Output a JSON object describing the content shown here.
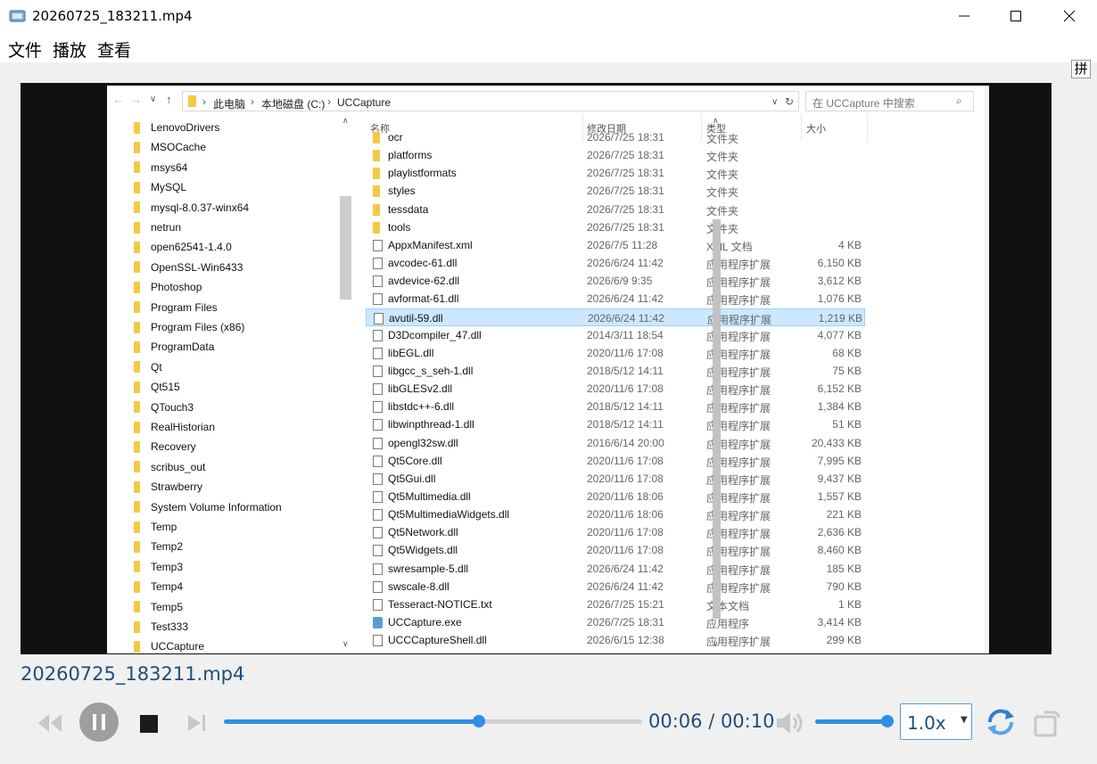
{
  "window": {
    "title": "20260725_183211.mp4",
    "icon": "video-player-icon",
    "minimize_icon": "minimize-icon",
    "maximize_icon": "maximize-icon",
    "close_icon": "close-icon"
  },
  "menu": [
    "文件",
    "播放",
    "查看"
  ],
  "ime_indicator": "拼",
  "explorer": {
    "breadcrumb": [
      "此电脑",
      "本地磁盘 (C:)",
      "UCCapture"
    ],
    "search_placeholder": "在 UCCapture 中搜索",
    "nav_folders": [
      "LenovoDrivers",
      "MSOCache",
      "msys64",
      "MySQL",
      "mysql-8.0.37-winx64",
      "netrun",
      "open62541-1.4.0",
      "OpenSSL-Win6433",
      "Photoshop",
      "Program Files",
      "Program Files (x86)",
      "ProgramData",
      "Qt",
      "Qt515",
      "QTouch3",
      "RealHistorian",
      "Recovery",
      "scribus_out",
      "Strawberry",
      "System Volume Information",
      "Temp",
      "Temp2",
      "Temp3",
      "Temp4",
      "Temp5",
      "Test333",
      "UCCapture"
    ],
    "columns": [
      "名称",
      "修改日期",
      "类型",
      "大小"
    ],
    "files": [
      {
        "name": "ocr",
        "date": "2026/7/25 18:31",
        "type": "文件夹",
        "size": "",
        "kind": "folder"
      },
      {
        "name": "platforms",
        "date": "2026/7/25 18:31",
        "type": "文件夹",
        "size": "",
        "kind": "folder"
      },
      {
        "name": "playlistformats",
        "date": "2026/7/25 18:31",
        "type": "文件夹",
        "size": "",
        "kind": "folder"
      },
      {
        "name": "styles",
        "date": "2026/7/25 18:31",
        "type": "文件夹",
        "size": "",
        "kind": "folder"
      },
      {
        "name": "tessdata",
        "date": "2026/7/25 18:31",
        "type": "文件夹",
        "size": "",
        "kind": "folder"
      },
      {
        "name": "tools",
        "date": "2026/7/25 18:31",
        "type": "文件夹",
        "size": "",
        "kind": "folder"
      },
      {
        "name": "AppxManifest.xml",
        "date": "2026/7/5 11:28",
        "type": "XML 文档",
        "size": "4 KB",
        "kind": "doc"
      },
      {
        "name": "avcodec-61.dll",
        "date": "2026/6/24 11:42",
        "type": "应用程序扩展",
        "size": "6,150 KB",
        "kind": "doc"
      },
      {
        "name": "avdevice-62.dll",
        "date": "2026/6/9 9:35",
        "type": "应用程序扩展",
        "size": "3,612 KB",
        "kind": "doc"
      },
      {
        "name": "avformat-61.dll",
        "date": "2026/6/24 11:42",
        "type": "应用程序扩展",
        "size": "1,076 KB",
        "kind": "doc"
      },
      {
        "name": "avutil-59.dll",
        "date": "2026/6/24 11:42",
        "type": "应用程序扩展",
        "size": "1,219 KB",
        "kind": "doc",
        "selected": true
      },
      {
        "name": "D3Dcompiler_47.dll",
        "date": "2014/3/11 18:54",
        "type": "应用程序扩展",
        "size": "4,077 KB",
        "kind": "doc"
      },
      {
        "name": "libEGL.dll",
        "date": "2020/11/6 17:08",
        "type": "应用程序扩展",
        "size": "68 KB",
        "kind": "doc"
      },
      {
        "name": "libgcc_s_seh-1.dll",
        "date": "2018/5/12 14:11",
        "type": "应用程序扩展",
        "size": "75 KB",
        "kind": "doc"
      },
      {
        "name": "libGLESv2.dll",
        "date": "2020/11/6 17:08",
        "type": "应用程序扩展",
        "size": "6,152 KB",
        "kind": "doc"
      },
      {
        "name": "libstdc++-6.dll",
        "date": "2018/5/12 14:11",
        "type": "应用程序扩展",
        "size": "1,384 KB",
        "kind": "doc"
      },
      {
        "name": "libwinpthread-1.dll",
        "date": "2018/5/12 14:11",
        "type": "应用程序扩展",
        "size": "51 KB",
        "kind": "doc"
      },
      {
        "name": "opengl32sw.dll",
        "date": "2016/6/14 20:00",
        "type": "应用程序扩展",
        "size": "20,433 KB",
        "kind": "doc"
      },
      {
        "name": "Qt5Core.dll",
        "date": "2020/11/6 17:08",
        "type": "应用程序扩展",
        "size": "7,995 KB",
        "kind": "doc"
      },
      {
        "name": "Qt5Gui.dll",
        "date": "2020/11/6 17:08",
        "type": "应用程序扩展",
        "size": "9,437 KB",
        "kind": "doc"
      },
      {
        "name": "Qt5Multimedia.dll",
        "date": "2020/11/6 18:06",
        "type": "应用程序扩展",
        "size": "1,557 KB",
        "kind": "doc"
      },
      {
        "name": "Qt5MultimediaWidgets.dll",
        "date": "2020/11/6 18:06",
        "type": "应用程序扩展",
        "size": "221 KB",
        "kind": "doc"
      },
      {
        "name": "Qt5Network.dll",
        "date": "2020/11/6 17:08",
        "type": "应用程序扩展",
        "size": "2,636 KB",
        "kind": "doc"
      },
      {
        "name": "Qt5Widgets.dll",
        "date": "2020/11/6 17:08",
        "type": "应用程序扩展",
        "size": "8,460 KB",
        "kind": "doc"
      },
      {
        "name": "swresample-5.dll",
        "date": "2026/6/24 11:42",
        "type": "应用程序扩展",
        "size": "185 KB",
        "kind": "doc"
      },
      {
        "name": "swscale-8.dll",
        "date": "2026/6/24 11:42",
        "type": "应用程序扩展",
        "size": "790 KB",
        "kind": "doc"
      },
      {
        "name": "Tesseract-NOTICE.txt",
        "date": "2026/7/25 15:21",
        "type": "文本文档",
        "size": "1 KB",
        "kind": "doc"
      },
      {
        "name": "UCCapture.exe",
        "date": "2026/7/25 18:31",
        "type": "应用程序",
        "size": "3,414 KB",
        "kind": "exe"
      },
      {
        "name": "UCCCaptureShell.dll",
        "date": "2026/6/15 12:38",
        "type": "应用程序扩展",
        "size": "299 KB",
        "kind": "doc"
      }
    ]
  },
  "player": {
    "filename": "20260725_183211.mp4",
    "time": "00:06 / 00:10",
    "progress_fraction": 0.61,
    "volume_fraction": 1.0,
    "speed": "1.0x",
    "accent": "#2f8ee5"
  }
}
